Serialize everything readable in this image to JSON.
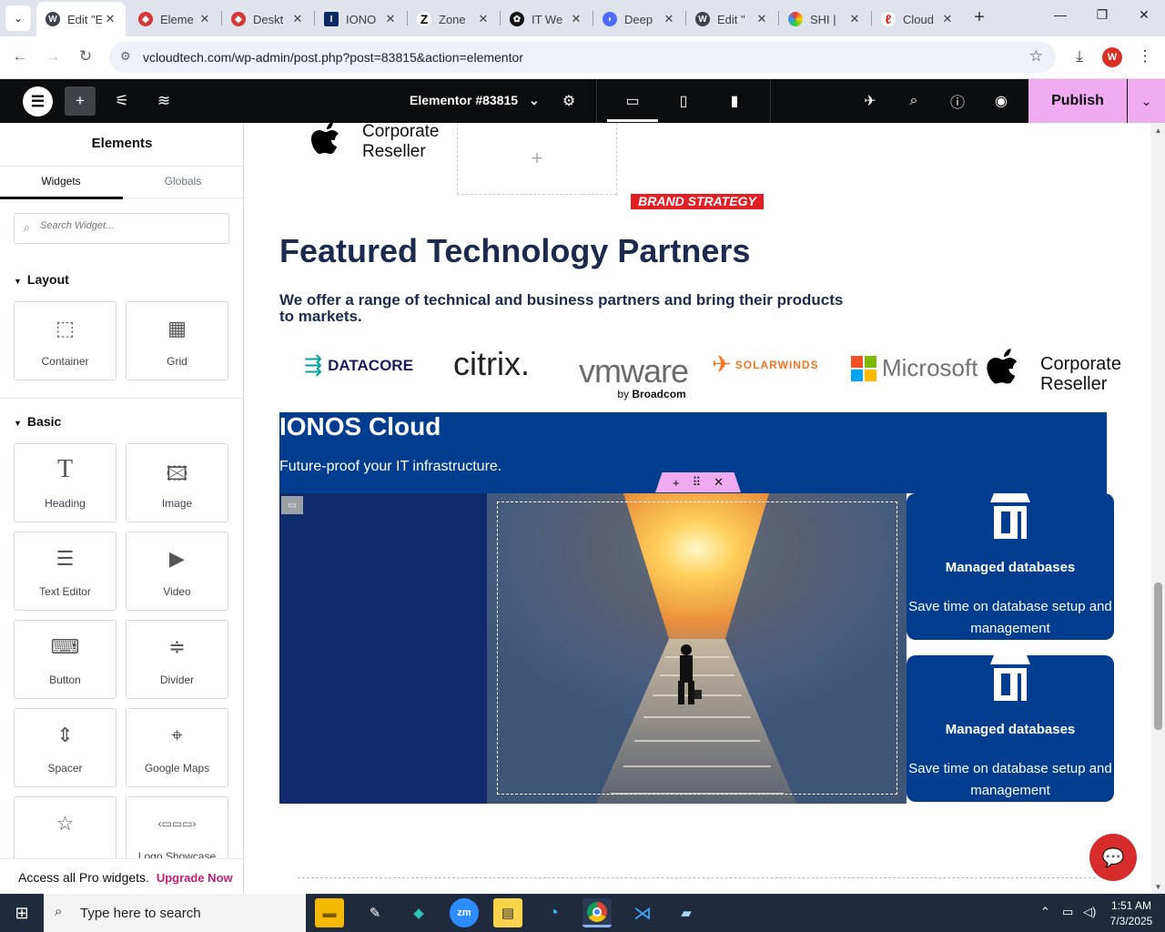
{
  "browser": {
    "tabs": [
      {
        "label": "Edit \"E",
        "icon": "wordpress-icon",
        "active": true
      },
      {
        "label": "Eleme",
        "icon": "elementor-red-icon"
      },
      {
        "label": "Deskt",
        "icon": "elementor-red-icon"
      },
      {
        "label": "IONO",
        "icon": "ionos-icon"
      },
      {
        "label": "Zone",
        "icon": "zdnet-icon"
      },
      {
        "label": "IT We",
        "icon": "chatgpt-icon"
      },
      {
        "label": "Deep",
        "icon": "deepseek-icon"
      },
      {
        "label": "Edit \"",
        "icon": "wordpress-icon"
      },
      {
        "label": "SHI |",
        "icon": "shi-icon"
      },
      {
        "label": "Cloud",
        "icon": "acrobat-icon"
      }
    ],
    "close_glyph": "✕",
    "url": "vcloudtech.com/wp-admin/post.php?post=83815&action=elementor",
    "profile_initial": "W"
  },
  "editor": {
    "doc_title": "Elementor #83815",
    "publish_label": "Publish"
  },
  "panel": {
    "title": "Elements",
    "tabs": [
      "Widgets",
      "Globals"
    ],
    "search_placeholder": "Search Widget...",
    "sections": {
      "layout": "Layout",
      "basic": "Basic"
    },
    "layout_widgets": [
      "Container",
      "Grid"
    ],
    "basic_widgets": [
      "Heading",
      "Image",
      "Text Editor",
      "Video",
      "Button",
      "Divider",
      "Spacer",
      "Google Maps",
      "",
      "Logo Showcase"
    ],
    "footer_text": "Access all Pro widgets.",
    "footer_link": "Upgrade Now"
  },
  "page": {
    "top_logo_text_1": "Corporate",
    "top_logo_text_2": "Reseller",
    "add_glyph": "+",
    "brand_tag": "BRAND STRATEGY",
    "heading": "Featured Technology Partners",
    "subheading": "We offer a range of technical and business partners and bring their products to markets.",
    "partners": {
      "datacore": "DATACORE",
      "citrix": "citrix.",
      "vmware": "vmware",
      "vmware_by": "by",
      "vmware_broadcom": "Broadcom",
      "solarwinds": "SOLARWINDS",
      "microsoft": "Microsoft",
      "apple_1": "Corporate",
      "apple_2": "Reseller"
    },
    "ionos_title": "IONOS Cloud",
    "ionos_subtitle": "Future-proof your IT infrastructure.",
    "cards": [
      {
        "title": "Managed databases",
        "desc": "Save time on database setup and management"
      },
      {
        "title": "Managed databases",
        "desc": "Save time on database setup and management"
      }
    ]
  },
  "taskbar": {
    "search_placeholder": "Type here to search",
    "time": "1:51 AM",
    "date": "7/3/2025"
  }
}
